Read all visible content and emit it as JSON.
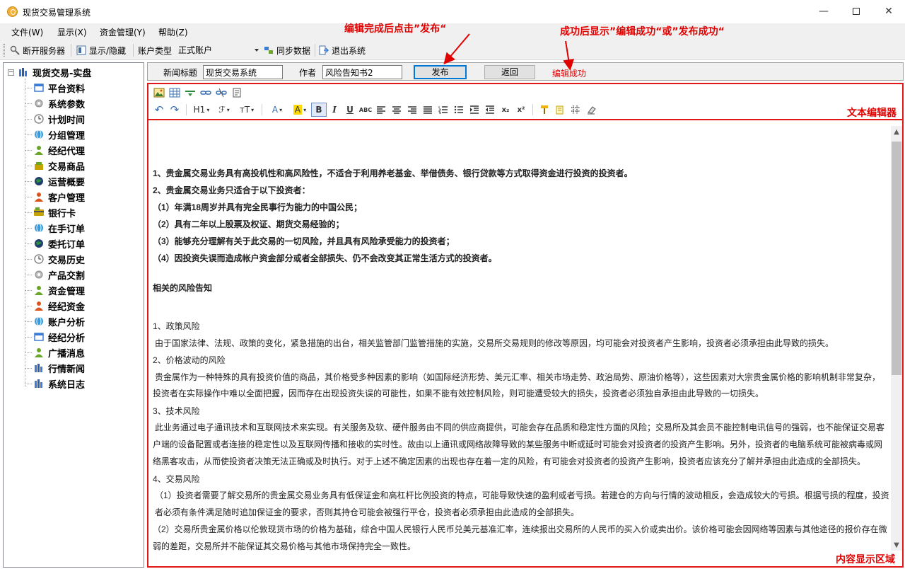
{
  "window": {
    "title": "现货交易管理系统",
    "minimize": "—",
    "close": "✕"
  },
  "menu": [
    {
      "label": "文件(W)"
    },
    {
      "label": "显示(X)"
    },
    {
      "label": "资金管理(Y)"
    },
    {
      "label": "帮助(Z)"
    }
  ],
  "toolbar": {
    "disconnect": "断开服务器",
    "toggle_display": "显示/隐藏",
    "account_type_label": "账户类型",
    "account_type_value": "正式账户",
    "sync": "同步数据",
    "exit": "退出系统"
  },
  "tree": {
    "root": "现货交易-实盘",
    "expander": "−",
    "items": [
      {
        "label": "平台资料",
        "icon": "window-icon",
        "color": "#3a7bd5"
      },
      {
        "label": "系统参数",
        "icon": "gear-icon",
        "color": "#888888"
      },
      {
        "label": "计划时间",
        "icon": "clock-icon",
        "color": "#888888"
      },
      {
        "label": "分组管理",
        "icon": "globe-icon",
        "color": "#3a9ad9"
      },
      {
        "label": "经纪代理",
        "icon": "user-icon",
        "color": "#6aa628"
      },
      {
        "label": "交易商品",
        "icon": "goods-icon",
        "color": "#c7a200"
      },
      {
        "label": "运营概要",
        "icon": "globe-dark-icon",
        "color": "#1f3f6f"
      },
      {
        "label": "客户管理",
        "icon": "user-icon",
        "color": "#d9541e"
      },
      {
        "label": "银行卡",
        "icon": "card-icon",
        "color": "#c7a200"
      },
      {
        "label": "在手订单",
        "icon": "globe-icon",
        "color": "#3a9ad9"
      },
      {
        "label": "委托订单",
        "icon": "globe-dark-icon",
        "color": "#1f3f6f"
      },
      {
        "label": "交易历史",
        "icon": "clock-icon",
        "color": "#888888"
      },
      {
        "label": "产品交割",
        "icon": "gear-icon",
        "color": "#888888"
      },
      {
        "label": "资金管理",
        "icon": "user-icon",
        "color": "#6aa628"
      },
      {
        "label": "经纪资金",
        "icon": "user-icon",
        "color": "#d9541e"
      },
      {
        "label": "账户分析",
        "icon": "globe-icon",
        "color": "#3a9ad9"
      },
      {
        "label": "经纪分析",
        "icon": "window-icon",
        "color": "#3a7bd5"
      },
      {
        "label": "广播消息",
        "icon": "user-icon",
        "color": "#6aa628"
      },
      {
        "label": "行情新闻",
        "icon": "bar-icon",
        "color": "#3a7bd5"
      },
      {
        "label": "系统日志",
        "icon": "bar-icon",
        "color": "#3a7bd5"
      }
    ]
  },
  "form": {
    "title_label": "新闻标题",
    "title_value": "现货交易系统",
    "author_label": "作者",
    "author_value": "风险告知书2",
    "publish": "发布",
    "back": "返回",
    "status": "编辑成功"
  },
  "editor": {
    "row2": {
      "undo": "↶",
      "redo": "↷",
      "heading": "H1",
      "font_family": "ℱ",
      "font_size": "тT",
      "font_color": "A",
      "highlight": "A",
      "bold": "B",
      "italic": "I",
      "underline": "U",
      "strike": "ABC",
      "subscript": "x₂",
      "superscript": "x²"
    }
  },
  "content": {
    "lines": [
      {
        "text": "1、贵金属交易业务具有高投机性和高风险性，不适合于利用养老基金、举借债务、银行贷款等方式取得资金进行投资的投资者。",
        "bold": true
      },
      {
        "text": "2、贵金属交易业务只适合于以下投资者：",
        "bold": true
      },
      {
        "text": "（1）年满18周岁并具有完全民事行为能力的中国公民；",
        "bold": true
      },
      {
        "text": "（2）具有二年以上股票及权证、期货交易经验的；",
        "bold": true
      },
      {
        "text": "（3）能够充分理解有关于此交易的一切风险，并且具有风险承受能力的投资者；",
        "bold": true
      },
      {
        "text": "（4）因投资失误而造成帐户资金部分或者全部损失、仍不会改变其正常生活方式的投资者。",
        "bold": true
      },
      {
        "text": "相关的风险告知",
        "bold": true
      },
      {
        "text": "1、政策风险",
        "bold": false
      },
      {
        "text": "由于国家法律、法规、政策的变化，紧急措施的出台，相关监管部门监管措施的实施，交易所交易规则的修改等原因，均可能会对投资者产生影响，投资者必须承担由此导致的损失。",
        "bold": false
      },
      {
        "text": "2、价格波动的风险",
        "bold": false
      },
      {
        "text": "贵金属作为一种特殊的具有投资价值的商品，其价格受多种因素的影响（如国际经济形势、美元汇率、相关市场走势、政治局势、原油价格等），这些因素对大宗贵金属价格的影响机制非常复杂，",
        "bold": false
      },
      {
        "text": "投资者在实际操作中难以全面把握，因而存在出现投资失误的可能性，如果不能有效控制风险，则可能遭受较大的损失，投资者必须独自承担由此导致的一切损失。",
        "bold": false
      },
      {
        "text": "3、技术风险",
        "bold": false
      },
      {
        "text": "此业务通过电子通讯技术和互联网技术来实现。有关服务及软、硬件服务由不同的供应商提供，可能会存在品质和稳定性方面的风险；交易所及其会员不能控制电讯信号的强弱，也不能保证交易客",
        "bold": false
      },
      {
        "text": "户端的设备配置或者连接的稳定性以及互联网传播和接收的实时性。故由以上通讯或网络故障导致的某些服务中断或延时可能会对投资者的投资产生影响。另外，投资者的电脑系统可能被病毒或网",
        "bold": false
      },
      {
        "text": "络黑客攻击，从而使投资者决策无法正确或及时执行。对于上述不确定因素的出现也存在着一定的风险，有可能会对投资者的投资产生影响，投资者应该充分了解并承担由此造成的全部损失。",
        "bold": false
      },
      {
        "text": "4、交易风险",
        "bold": false
      },
      {
        "text": "（1）投资者需要了解交易所的贵金属交易业务具有低保证金和高杠杆比例投资的特点，可能导致快速的盈利或者亏损。若建仓的方向与行情的波动相反，会造成较大的亏损。根据亏损的程度，投资",
        "bold": false
      },
      {
        "text": "者必须有条件满足随时追加保证金的要求，否则其持仓可能会被强行平仓，投资者必须承担由此造成的全部损失。",
        "bold": false
      },
      {
        "text": "（2）交易所贵金属价格以伦敦现货市场的价格为基础，综合中国人民银行人民币兑美元基准汇率，连续报出交易所的人民币的买入价或卖出价。该价格可能会因网络等因素与其他途径的报价存在微",
        "bold": false
      },
      {
        "text": "弱的差距，交易所并不能保证其交易价格与其他市场保持完全一致性。",
        "bold": false
      }
    ]
  },
  "annotations": {
    "publish_hint": "编辑完成后点击”发布“",
    "success_hint": "成功后显示”编辑成功“或”发布成功“",
    "editor_label": "文本编辑器",
    "content_label": "内容显示区域"
  }
}
